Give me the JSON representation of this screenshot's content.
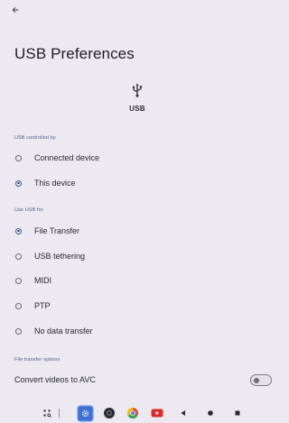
{
  "page": {
    "title": "USB Preferences"
  },
  "hero": {
    "icon": "usb-icon",
    "caption": "USB"
  },
  "sections": {
    "controlled_by": {
      "header": "USB controlled by",
      "options": [
        {
          "label": "Connected device",
          "checked": false
        },
        {
          "label": "This device",
          "checked": true
        }
      ]
    },
    "use_usb_for": {
      "header": "Use USB for",
      "options": [
        {
          "label": "File Transfer",
          "checked": true
        },
        {
          "label": "USB tethering",
          "checked": false
        },
        {
          "label": "MIDI",
          "checked": false
        },
        {
          "label": "PTP",
          "checked": false
        },
        {
          "label": "No data transfer",
          "checked": false
        }
      ]
    },
    "file_transfer_options": {
      "header": "File transfer options",
      "toggle": {
        "label": "Convert videos to AVC",
        "on": false
      }
    }
  },
  "taskbar": {
    "items": [
      "app-drawer-icon",
      "settings-icon",
      "camera-icon",
      "chrome-icon",
      "youtube-icon",
      "back-icon",
      "home-icon",
      "recents-icon"
    ]
  },
  "colors": {
    "background": "#ece9f0",
    "accent": "#4a5492",
    "section_header": "#4f5b8d"
  }
}
